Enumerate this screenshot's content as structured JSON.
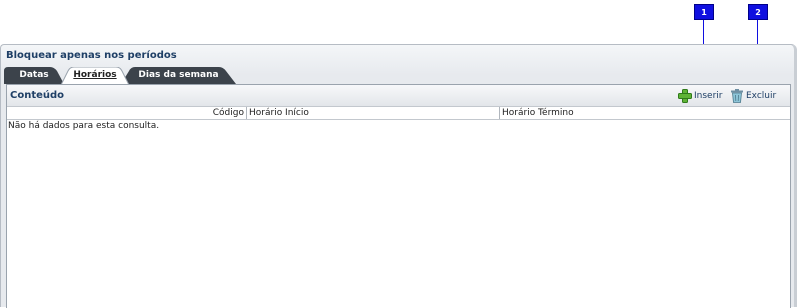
{
  "callouts": [
    "1",
    "2"
  ],
  "section_title": "Bloquear apenas nos períodos",
  "tabs": [
    {
      "label": "Datas",
      "active": false
    },
    {
      "label": "Horários",
      "active": true
    },
    {
      "label": "Dias da semana",
      "active": false
    }
  ],
  "panel": {
    "title": "Conteúdo",
    "toolbar": {
      "insert_label": "Inserir",
      "insert_icon": "green-plus-icon",
      "delete_label": "Excluir",
      "delete_icon": "trash-bin-icon"
    },
    "columns": [
      "Código",
      "Horário Início",
      "Horário Término"
    ],
    "empty_message": "Não há dados para esta consulta."
  },
  "colors": {
    "callout": "#1010e0",
    "title": "#1f3f66",
    "tab_dark": "#3c434b",
    "tab_active": "#ffffff"
  }
}
